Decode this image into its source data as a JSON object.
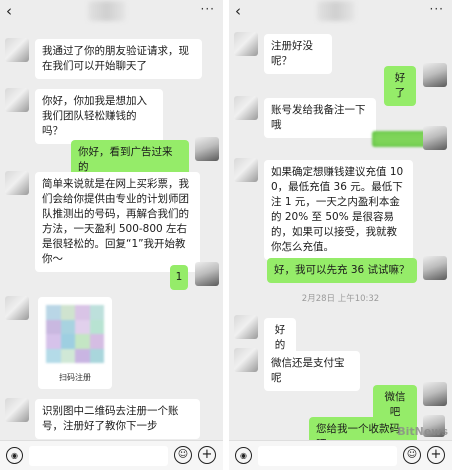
{
  "left": {
    "messages": [
      {
        "from": "in",
        "text": "我通过了你的朋友验证请求，现在我们可以开始聊天了"
      },
      {
        "from": "in",
        "text": "你好，你加我是想加入我们团队轻松赚钱的吗？"
      },
      {
        "from": "out",
        "text": "你好，看到广告过来的"
      },
      {
        "from": "in",
        "text": "简单来说就是在网上买彩票，我们会给你提供由专业的计划师团队推测出的号码，再解合我们的方法，一天盈利 500-800 左右是很轻松的。回复“1”我开始教你～"
      },
      {
        "from": "out",
        "text": "1"
      },
      {
        "from": "in",
        "text": "识别图中二维码去注册一个账号，注册好了教你下一步"
      }
    ],
    "qr_label": "扫码注册"
  },
  "right": {
    "messages": [
      {
        "from": "in",
        "text": "注册好没呢？"
      },
      {
        "from": "out",
        "text": "好了"
      },
      {
        "from": "in",
        "text": "账号发给我备注一下哦"
      },
      {
        "from": "in",
        "text": "如果确定想赚钱建议充值 100，最低充值 36 元。最低下注 1 元，一天之内盈利本金的 20% 至 50% 是很容易的，如果可以接受，我就教你怎么充值。"
      },
      {
        "from": "out",
        "text": "好，我可以先充 36 试试嘛？"
      },
      {
        "from": "in",
        "text": "好的"
      },
      {
        "from": "in",
        "text": "微信还是支付宝呢"
      },
      {
        "from": "out",
        "text": "微信吧"
      },
      {
        "from": "out",
        "text": "您给我一个收款码吧"
      }
    ],
    "timestamp": "2月28日 上午10:32"
  },
  "top_bar": {
    "back_icon": "‹",
    "more_icon": "···"
  },
  "bottom_bar": {
    "voice_icon": "◉",
    "emoji_icon": "☺",
    "plus_icon": "+"
  },
  "watermark": "BitNews",
  "colors": {
    "incoming_bubble": "#ffffff",
    "outgoing_bubble": "#95ec69",
    "background": "#ededed"
  }
}
